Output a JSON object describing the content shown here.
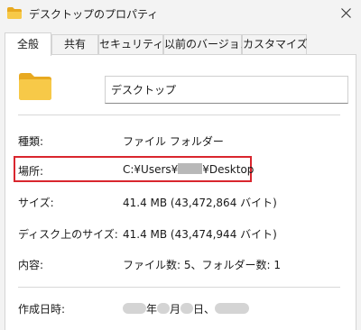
{
  "window": {
    "title": "デスクトップのプロパティ"
  },
  "tabs": [
    {
      "label": "全般"
    },
    {
      "label": "共有"
    },
    {
      "label": "セキュリティ"
    },
    {
      "label": "以前のバージョン"
    },
    {
      "label": "カスタマイズ"
    }
  ],
  "general": {
    "name_value": "デスクトップ",
    "type_label": "種類:",
    "type_value": "ファイル フォルダー",
    "location_label": "場所:",
    "location_prefix": "C:¥Users¥",
    "location_suffix": "¥Desktop",
    "size_label": "サイズ:",
    "size_value": "41.4 MB (43,472,864 バイト)",
    "disk_size_label": "ディスク上のサイズ:",
    "disk_size_value": "41.4 MB (43,474,944 バイト)",
    "contents_label": "内容:",
    "contents_value": "ファイル数: 5、フォルダー数: 1",
    "created_label": "作成日時:",
    "created_year_sep": "年",
    "created_month_sep": "月",
    "created_day_sep": "日、"
  },
  "colors": {
    "highlight": "#d9262e",
    "folder": "#f7c948"
  },
  "icons": {
    "title_icon": "folder-icon",
    "big_icon": "folder-icon",
    "close": "close-icon"
  }
}
